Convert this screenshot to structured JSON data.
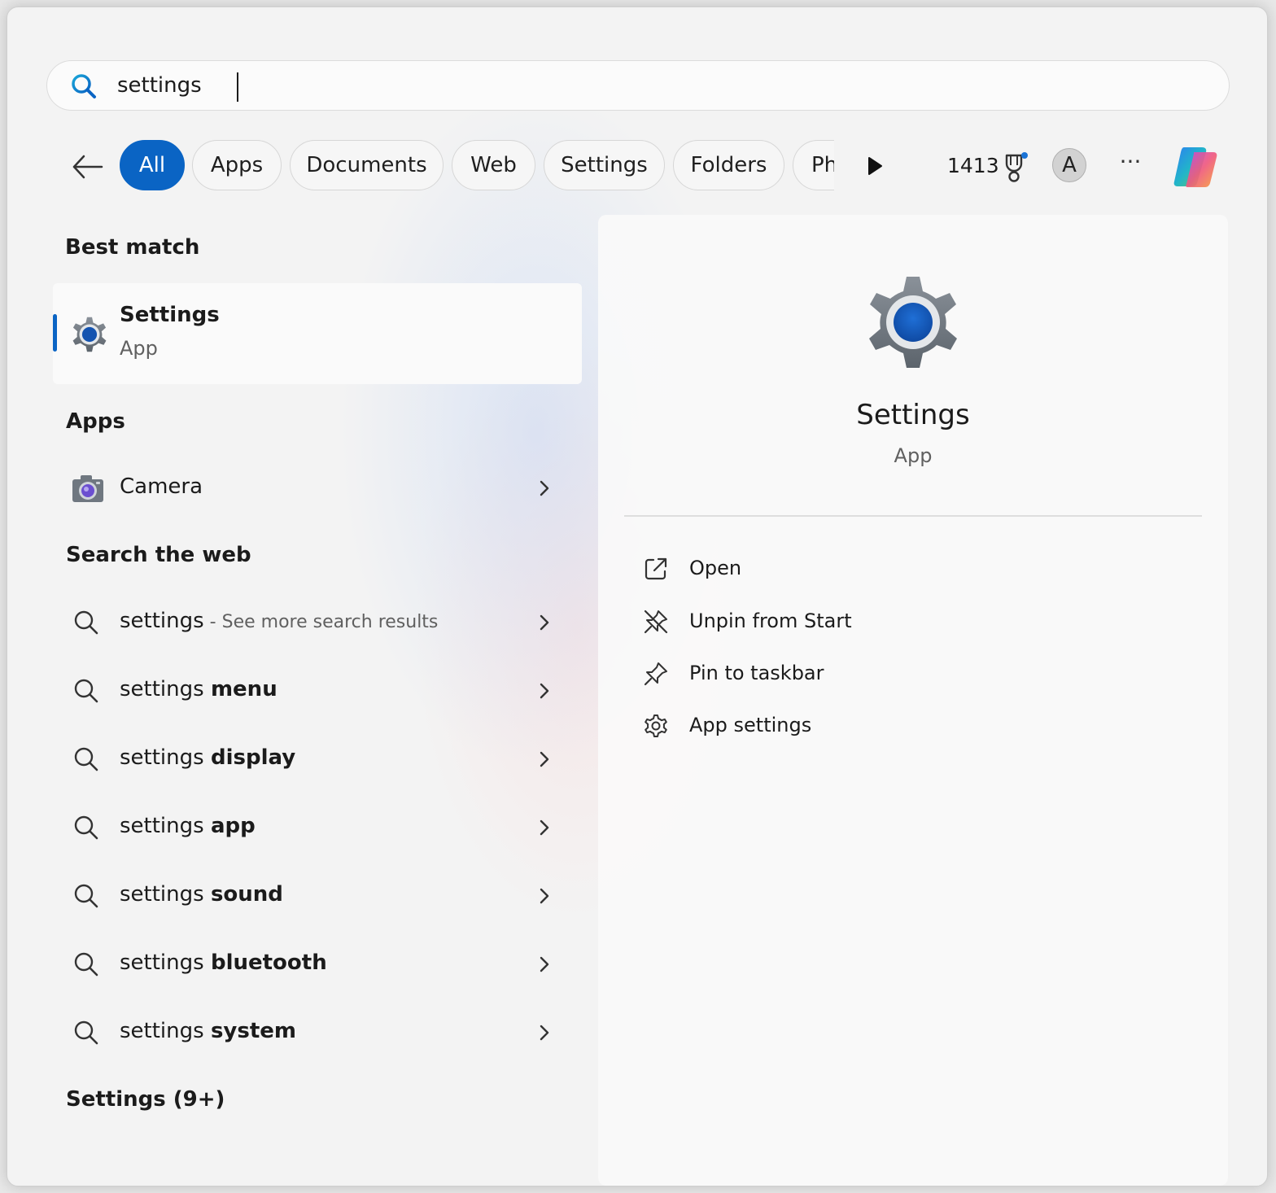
{
  "search": {
    "value": "settings",
    "icon": "search-icon"
  },
  "filters": {
    "chips": [
      {
        "label": "All",
        "active": true
      },
      {
        "label": "Apps",
        "active": false
      },
      {
        "label": "Documents",
        "active": false
      },
      {
        "label": "Web",
        "active": false
      },
      {
        "label": "Settings",
        "active": false
      },
      {
        "label": "Folders",
        "active": false
      },
      {
        "label": "Ph",
        "active": false
      }
    ],
    "points": "1413",
    "avatar_letter": "A",
    "more_label": "···"
  },
  "best_match": {
    "heading": "Best match",
    "title": "Settings",
    "subtitle": "App"
  },
  "apps": {
    "heading": "Apps",
    "items": [
      {
        "label": "Camera",
        "icon": "camera-icon"
      }
    ]
  },
  "web": {
    "heading": "Search the web",
    "first": {
      "prefix": "settings",
      "hint": " - See more search results"
    },
    "items": [
      {
        "prefix": "settings ",
        "bold": "menu"
      },
      {
        "prefix": "settings ",
        "bold": "display"
      },
      {
        "prefix": "settings ",
        "bold": "app"
      },
      {
        "prefix": "settings ",
        "bold": "sound"
      },
      {
        "prefix": "settings ",
        "bold": "bluetooth"
      },
      {
        "prefix": "settings ",
        "bold": "system"
      }
    ]
  },
  "settings_section": {
    "heading": "Settings (9+)"
  },
  "detail": {
    "title": "Settings",
    "subtitle": "App",
    "actions": [
      {
        "label": "Open",
        "icon": "open-external-icon"
      },
      {
        "label": "Unpin from Start",
        "icon": "unpin-icon"
      },
      {
        "label": "Pin to taskbar",
        "icon": "pin-icon"
      },
      {
        "label": "App settings",
        "icon": "gear-outline-icon"
      }
    ]
  },
  "colors": {
    "accent": "#0a64c4",
    "background": "#f3f3f3",
    "panel": "#fafafa"
  }
}
